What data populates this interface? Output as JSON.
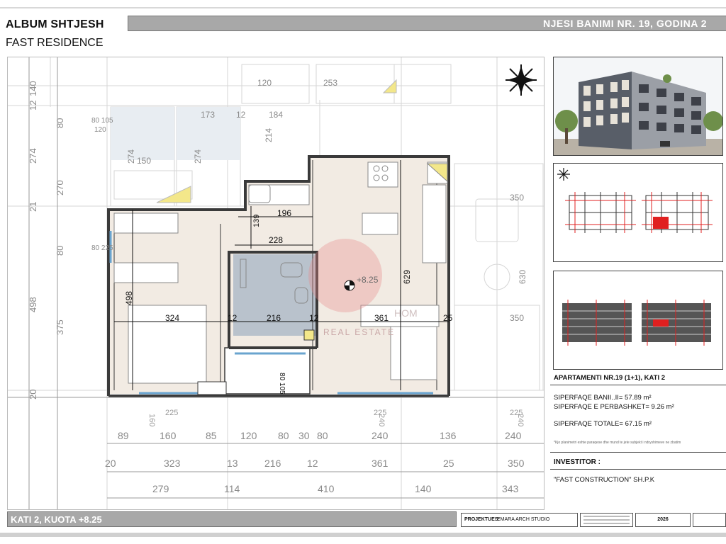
{
  "header": {
    "album_title": "ALBUM SHTJESH",
    "project_name": "FAST RESIDENCE",
    "unit_title": "NJESI BANIMI NR. 19, GODINA 2"
  },
  "plan": {
    "elevation_label": "+8.25",
    "watermark_line1": "HOM",
    "watermark_line2": "REAL ESTATE",
    "room_dims": [
      "324",
      "12",
      "216",
      "12",
      "361",
      "25"
    ],
    "inner_dims": [
      "196",
      "228",
      "139",
      "498",
      "629"
    ],
    "top_dims": [
      "120",
      "253",
      "173",
      "12",
      "184",
      "214",
      "274",
      "150",
      "274",
      "350",
      "630",
      "350"
    ],
    "left_dims": [
      "140",
      "12",
      "80",
      "274",
      "270",
      "21",
      "80",
      "498",
      "375",
      "20"
    ],
    "window_dims": [
      "80 105",
      "120",
      "80 225",
      "80 105"
    ],
    "sub_dims": [
      "160",
      "225",
      "240",
      "225",
      "240",
      "225"
    ],
    "dim_row1": [
      "89",
      "160",
      "85",
      "120",
      "80",
      "30",
      "80",
      "240",
      "136",
      "240"
    ],
    "dim_row2": [
      "20",
      "323",
      "13",
      "216",
      "12",
      "361",
      "25",
      "350"
    ],
    "dim_row3": [
      "279",
      "114",
      "410",
      "140",
      "343"
    ]
  },
  "info": {
    "apartment_title": "APARTAMENTI NR.19 (1+1), KATI 2",
    "area_net": "SIPERFAQE BANII..II= 57.89 m²",
    "area_common": "SIPERFAQE E PERBASHKET= 9.26 m²",
    "area_total": "SIPERFAQE TOTALE= 67.15 m²",
    "note": "*Kjo planimetri eshte paraqese dhe mund te jete subjekt i ndryshimeve ne zbatim",
    "investor_label": "INVESTITOR :",
    "investor_value": "\"FAST CONSTRUCTION\" SH.P.K"
  },
  "footer": {
    "floor_label": "KATI 2, KUOTA +8.25",
    "designer_label": "PROJEKTUES:",
    "designer_value": "EMARA ARCH STUDIO",
    "year": "2026"
  },
  "colors": {
    "header_bar": "#a8a8a8",
    "wall": "#3a3a3a",
    "bathroom_fill": "#b9c2cc",
    "floor_fill": "#efe6dc",
    "balcony_line": "#6aa4cf",
    "highlight_red": "#e02020",
    "watermark_red": "#e88a8a"
  }
}
